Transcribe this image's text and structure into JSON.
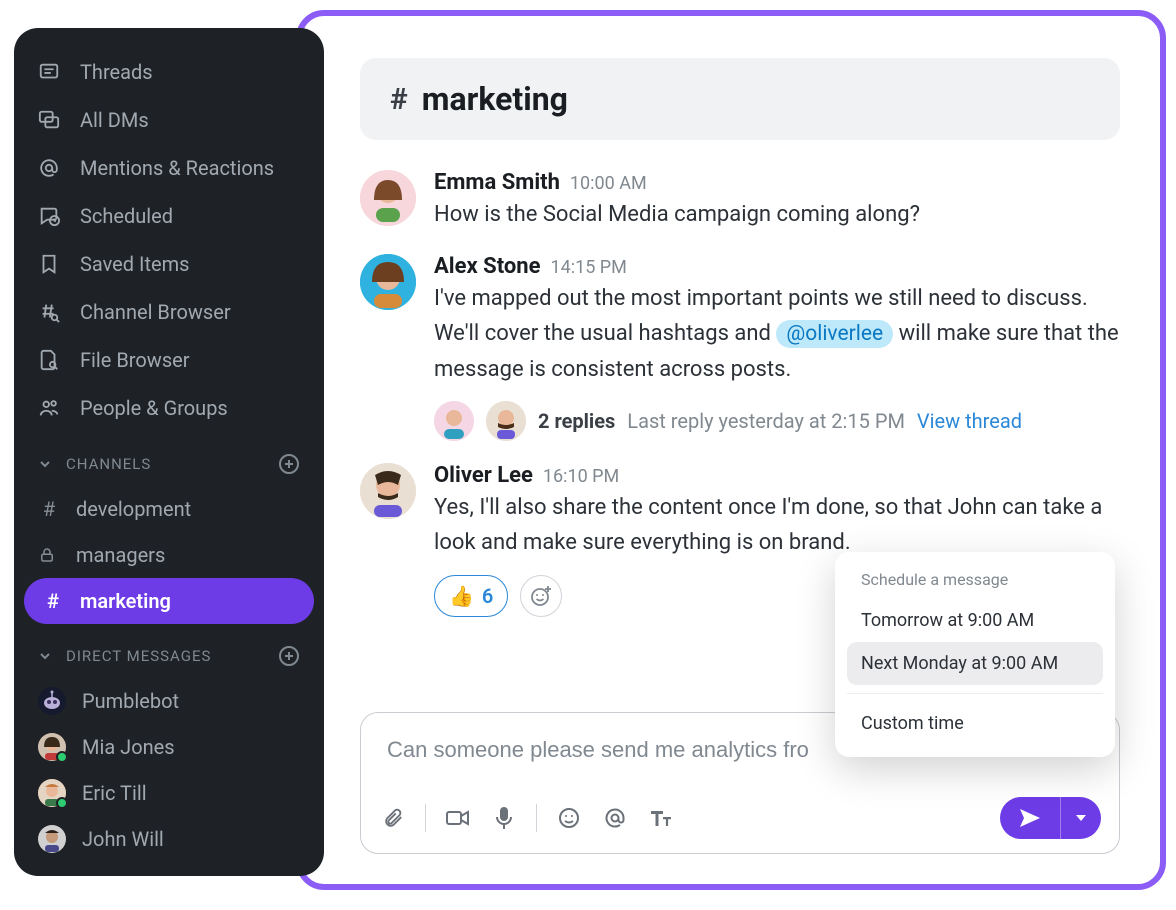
{
  "sidebar": {
    "nav": [
      {
        "label": "Threads",
        "icon": "threads"
      },
      {
        "label": "All DMs",
        "icon": "all-dms"
      },
      {
        "label": "Mentions & Reactions",
        "icon": "mentions"
      },
      {
        "label": "Scheduled",
        "icon": "scheduled"
      },
      {
        "label": "Saved Items",
        "icon": "bookmark"
      },
      {
        "label": "Channel Browser",
        "icon": "channel-browser"
      },
      {
        "label": "File Browser",
        "icon": "file-browser"
      },
      {
        "label": "People & Groups",
        "icon": "people"
      }
    ],
    "channels_header": "CHANNELS",
    "channels": [
      {
        "name": "development",
        "type": "public",
        "active": false
      },
      {
        "name": "managers",
        "type": "private",
        "active": false
      },
      {
        "name": "marketing",
        "type": "public",
        "active": true
      }
    ],
    "dms_header": "DIRECT MESSAGES",
    "dms": [
      {
        "name": "Pumblebot",
        "avatar_bg": "#161a2e",
        "presence": false
      },
      {
        "name": "Mia Jones",
        "avatar_bg": "#8b5a42",
        "presence": true
      },
      {
        "name": "Eric Till",
        "avatar_bg": "#c67a3e",
        "presence": true
      },
      {
        "name": "John Will",
        "avatar_bg": "#3a2f2a",
        "presence": false
      }
    ]
  },
  "channel": {
    "name": "marketing"
  },
  "messages": [
    {
      "author": "Emma Smith",
      "time": "10:00 AM",
      "avatar_bg": "#f7d6dc",
      "text": "How is the Social Media campaign coming along?"
    },
    {
      "author": "Alex Stone",
      "time": "14:15 PM",
      "avatar_bg": "#2fb2e0",
      "text_before": "I've mapped out the most important points we still need to discuss.  We'll cover the usual hashtags and ",
      "mention": "@oliverlee",
      "text_after": " will make sure that the message is consistent across posts.",
      "thread": {
        "replies_label": "2 replies",
        "last_reply": "Last reply yesterday at 2:15 PM",
        "view_thread": "View thread"
      }
    },
    {
      "author": "Oliver Lee",
      "time": "16:10 PM",
      "avatar_bg": "#eadfd3",
      "text": "Yes, I'll also share the content once I'm done, so that John can take a look and make sure everything is on brand.",
      "reactions": [
        {
          "emoji": "👍",
          "count": 6
        }
      ]
    }
  ],
  "composer": {
    "value": "Can someone please send me analytics fro"
  },
  "schedule_popup": {
    "title": "Schedule a message",
    "items": [
      {
        "label": "Tomorrow at 9:00 AM",
        "selected": false
      },
      {
        "label": "Next Monday at 9:00 AM",
        "selected": true
      }
    ],
    "custom_label": "Custom time"
  }
}
